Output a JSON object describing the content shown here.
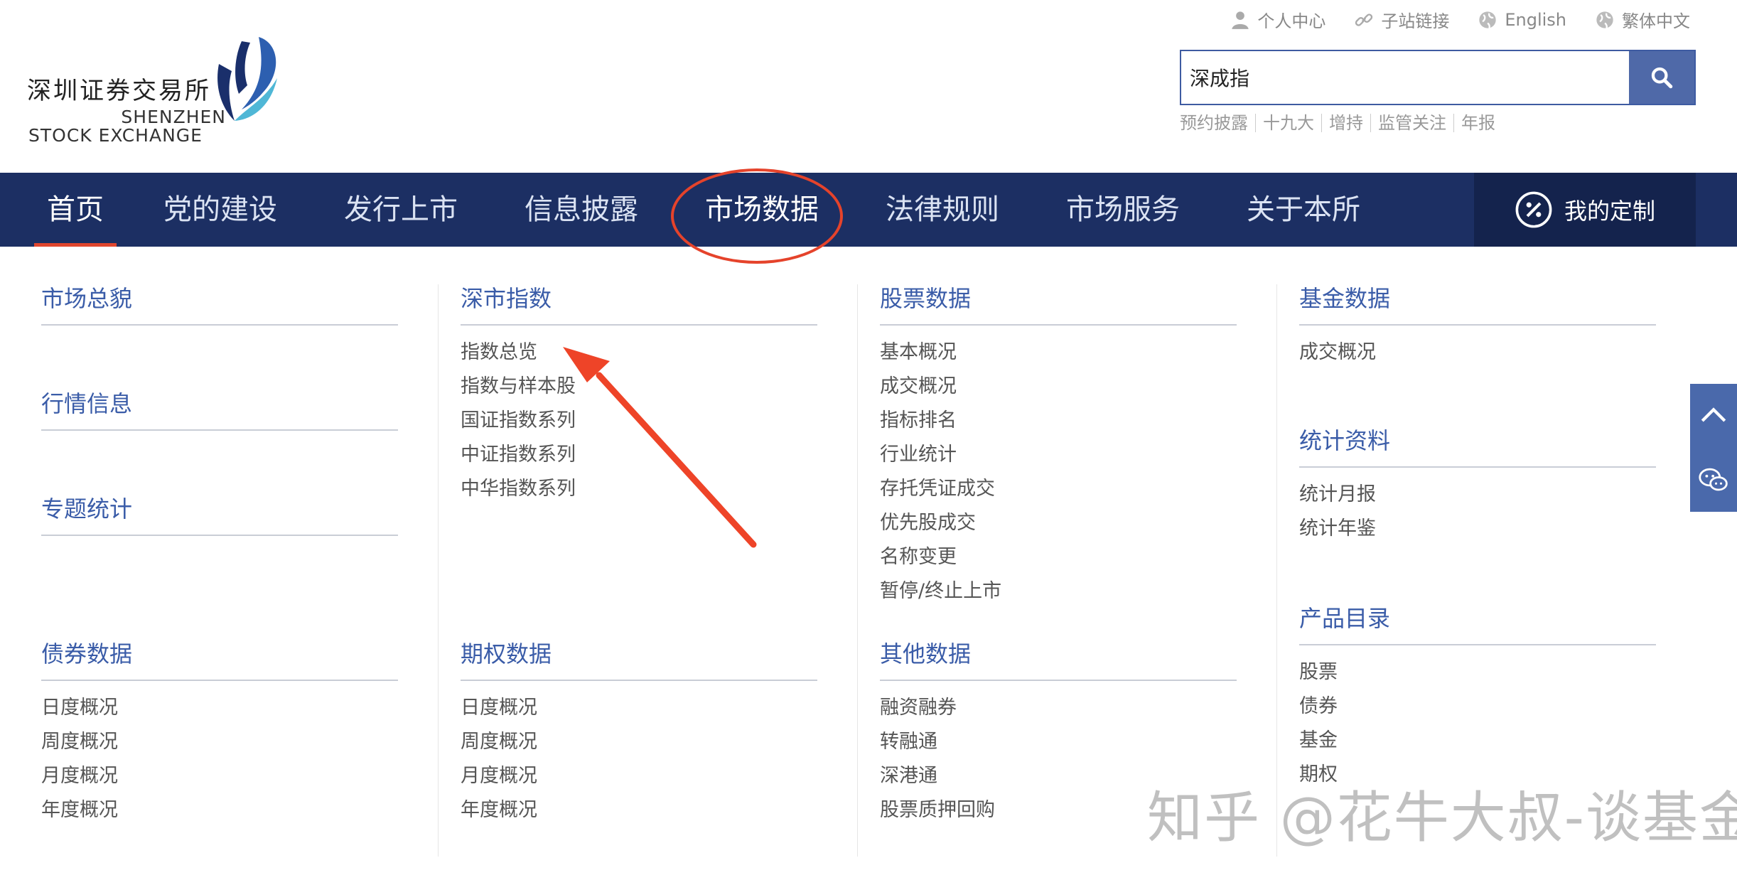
{
  "header": {
    "logo_cn": "深圳证券交易所",
    "logo_en_line1": "SHENZHEN",
    "logo_en_line2": "STOCK EXCHANGE",
    "toplinks": [
      {
        "label": "个人中心",
        "icon": "user-icon"
      },
      {
        "label": "子站链接",
        "icon": "link-icon"
      },
      {
        "label": "English",
        "icon": "globe-icon"
      },
      {
        "label": "繁体中文",
        "icon": "globe-icon"
      }
    ],
    "search": {
      "value": "深成指",
      "icon": "search-icon"
    },
    "hotwords": [
      "预约披露",
      "十九大",
      "增持",
      "监管关注",
      "年报"
    ]
  },
  "nav": {
    "items": [
      "首页",
      "党的建设",
      "发行上市",
      "信息披露",
      "市场数据",
      "法律规则",
      "市场服务",
      "关于本所"
    ],
    "active": "首页",
    "highlighted": "市场数据",
    "custom_label": "我的定制",
    "colors": {
      "bar": "#1c2f63",
      "active_underline": "#e0462e",
      "circle": "#e5432b"
    }
  },
  "menu": {
    "col1": [
      {
        "title": "市场总貌",
        "items": []
      },
      {
        "title": "行情信息",
        "items": []
      },
      {
        "title": "专题统计",
        "items": []
      },
      {
        "title": "债券数据",
        "items": [
          "日度概况",
          "周度概况",
          "月度概况",
          "年度概况"
        ]
      }
    ],
    "col2": [
      {
        "title": "深市指数",
        "items": [
          "指数总览",
          "指数与样本股",
          "国证指数系列",
          "中证指数系列",
          "中华指数系列"
        ]
      },
      {
        "title": "期权数据",
        "items": [
          "日度概况",
          "周度概况",
          "月度概况",
          "年度概况"
        ]
      }
    ],
    "col3": [
      {
        "title": "股票数据",
        "items": [
          "基本概况",
          "成交概况",
          "指标排名",
          "行业统计",
          "存托凭证成交",
          "优先股成交",
          "名称变更",
          "暂停/终止上市"
        ]
      },
      {
        "title": "其他数据",
        "items": [
          "融资融券",
          "转融通",
          "深港通",
          "股票质押回购"
        ]
      }
    ],
    "col4": [
      {
        "title": "基金数据",
        "items": [
          "成交概况"
        ]
      },
      {
        "title": "统计资料",
        "items": [
          "统计月报",
          "统计年鉴"
        ]
      },
      {
        "title": "产品目录",
        "items": [
          "股票",
          "债券",
          "基金",
          "期权"
        ]
      }
    ]
  },
  "side": {
    "buttons": [
      "chevron-up-icon",
      "wechat-icon"
    ]
  },
  "watermark": "知乎 @花牛大叔-谈基金"
}
